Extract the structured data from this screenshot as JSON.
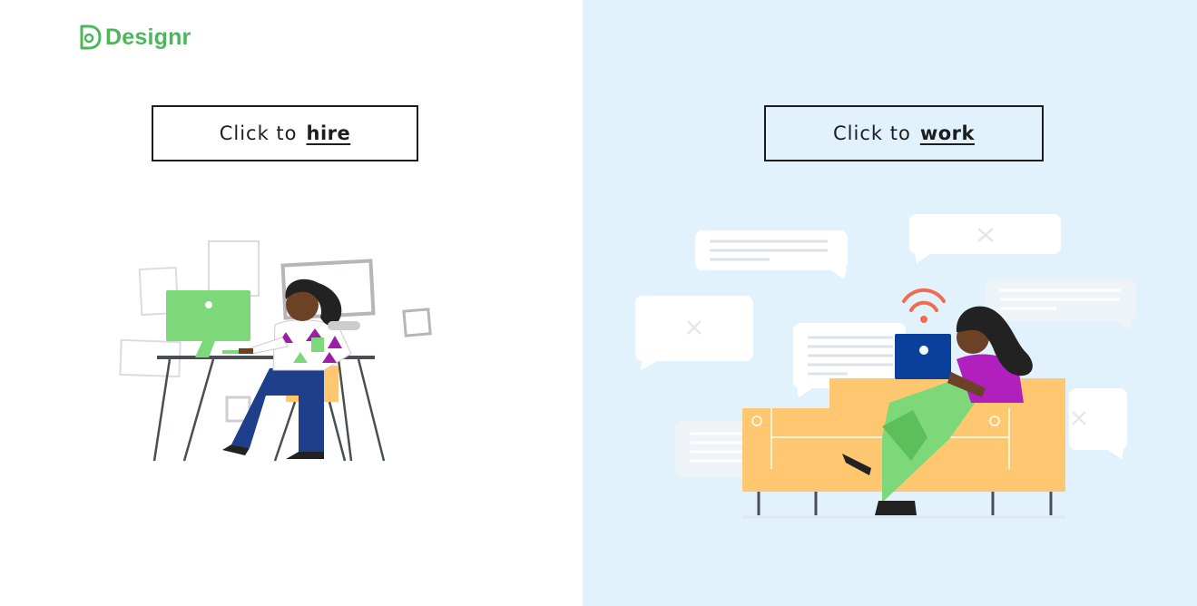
{
  "brand": {
    "name": "Designr",
    "color": "#4cb75a",
    "icon": "designr-logo-icon"
  },
  "left_panel": {
    "background": "#ffffff",
    "cta": {
      "prefix": "Click to",
      "action": "hire"
    },
    "illustration": "woman-at-desk-illustration"
  },
  "right_panel": {
    "background": "#e2f2fd",
    "cta": {
      "prefix": "Click to",
      "action": "work"
    },
    "illustration": "woman-on-sofa-with-laptop-illustration"
  }
}
